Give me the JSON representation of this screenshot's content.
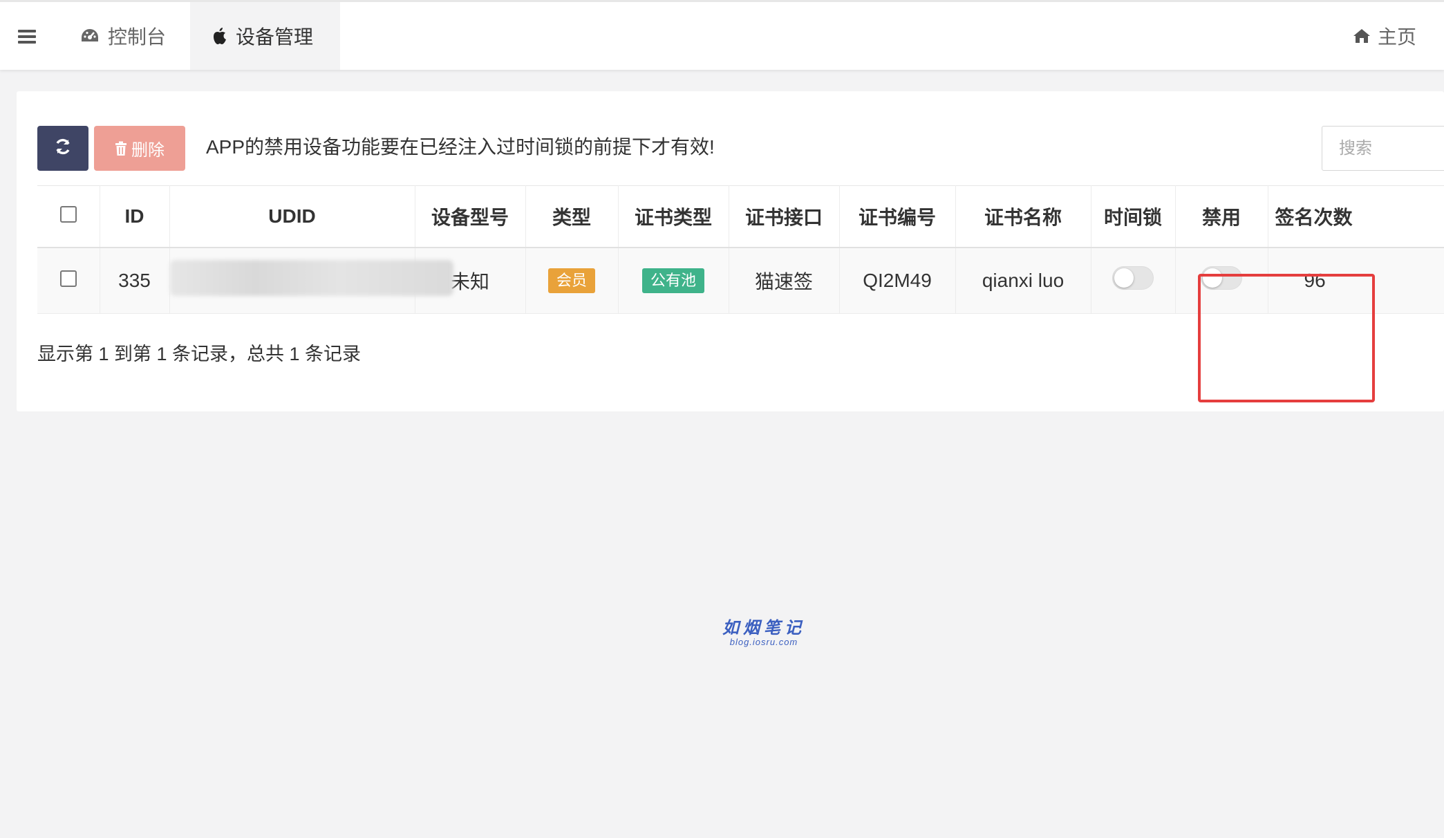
{
  "topbar": {
    "menu_icon": "hamburger-icon",
    "tabs": [
      {
        "label": "控制台",
        "icon": "dashboard-icon",
        "active": false
      },
      {
        "label": "设备管理",
        "icon": "apple-icon",
        "active": true
      }
    ],
    "home": {
      "label": "主页",
      "icon": "home-icon"
    }
  },
  "toolbar": {
    "refresh_icon": "refresh-icon",
    "delete_label": "删除",
    "delete_icon": "trash-icon",
    "notice": "APP的禁用设备功能要在已经注入过时间锁的前提下才有效!",
    "search_placeholder": "搜索"
  },
  "table": {
    "headers": [
      "ID",
      "UDID",
      "设备型号",
      "类型",
      "证书类型",
      "证书接口",
      "证书编号",
      "证书名称",
      "时间锁",
      "禁用",
      "签名次数"
    ],
    "rows": [
      {
        "id": "335",
        "udid": "",
        "device_model": "未知",
        "type": "会员",
        "cert_type": "公有池",
        "cert_api": "猫速签",
        "cert_no": "QI2M49",
        "cert_name": "qianxi luo",
        "time_lock": false,
        "disabled": false,
        "sign_count": "96"
      }
    ]
  },
  "pagination": {
    "summary": "显示第 1 到第 1 条记录，总共 1 条记录"
  },
  "watermark": {
    "line1": "如烟笔记",
    "line2": "blog.iosru.com"
  },
  "colors": {
    "refresh_button": "#3f4565",
    "delete_button": "#ee9f95",
    "badge_member": "#e9a23a",
    "badge_public": "#3fb38a",
    "highlight": "#e53e3e"
  }
}
